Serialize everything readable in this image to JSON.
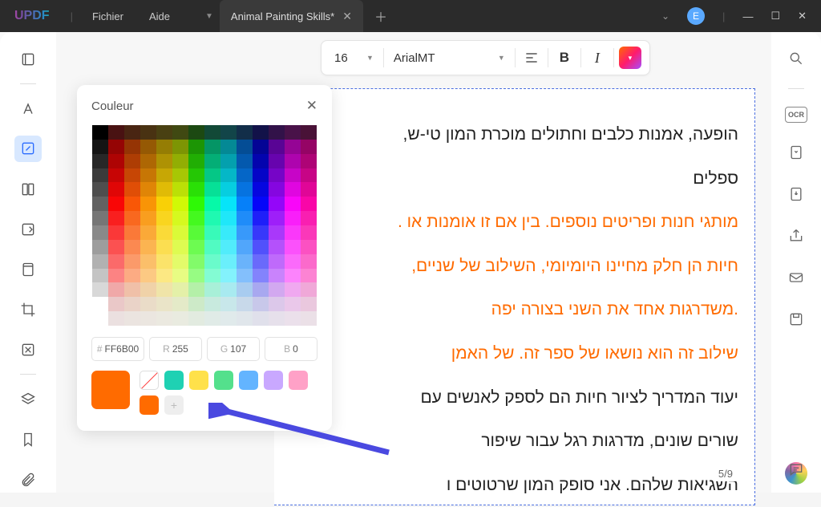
{
  "app": {
    "logo": "UPDF"
  },
  "menu": {
    "file": "Fichier",
    "help": "Aide"
  },
  "tab": {
    "title": "Animal Painting Skills*"
  },
  "avatar": {
    "initial": "E"
  },
  "toolbar": {
    "fontSize": "16",
    "fontName": "ArialMT"
  },
  "colorPopup": {
    "title": "Couleur",
    "hexLabel": "#",
    "hex": "FF6B00",
    "rLabel": "R",
    "r": "255",
    "gLabel": "G",
    "g": "107",
    "bLabel": "B",
    "b": "0",
    "presets": [
      "none",
      "#1fd1b3",
      "#ffe14a",
      "#54e08c",
      "#63b4ff",
      "#c9a8ff",
      "#ffa1c7",
      "#ff6b00",
      "add"
    ]
  },
  "doc": {
    "lines": [
      {
        "cls": "black",
        "text": "הופעה, אמנות כלבים וחתולים מוכרת המון טי-ש,"
      },
      {
        "cls": "black",
        "text": "ספלים"
      },
      {
        "cls": "orange",
        "text": "מותגי חנות ופריטים נוספים. בין אם זו אומנות או ."
      },
      {
        "cls": "orange",
        "text": "חיות הן חלק מחיינו היומיומי, השילוב של שניים,"
      },
      {
        "cls": "orange",
        "text": ".משדרגות אחד את השני בצורה יפה"
      },
      {
        "cls": "orange",
        "text": "שילוב זה הוא נושאו של ספר זה. של האמן"
      },
      {
        "cls": "black",
        "text": "יעוד המדריך לציור חיות הם לספק לאנשים עם"
      },
      {
        "cls": "black",
        "text": "שורים שונים, מדרגות רגל עבור שיפור"
      },
      {
        "cls": "black",
        "text": "השגיאות שלהם. אני סופק המון שרטוטים ו"
      }
    ],
    "page": "5/9"
  }
}
